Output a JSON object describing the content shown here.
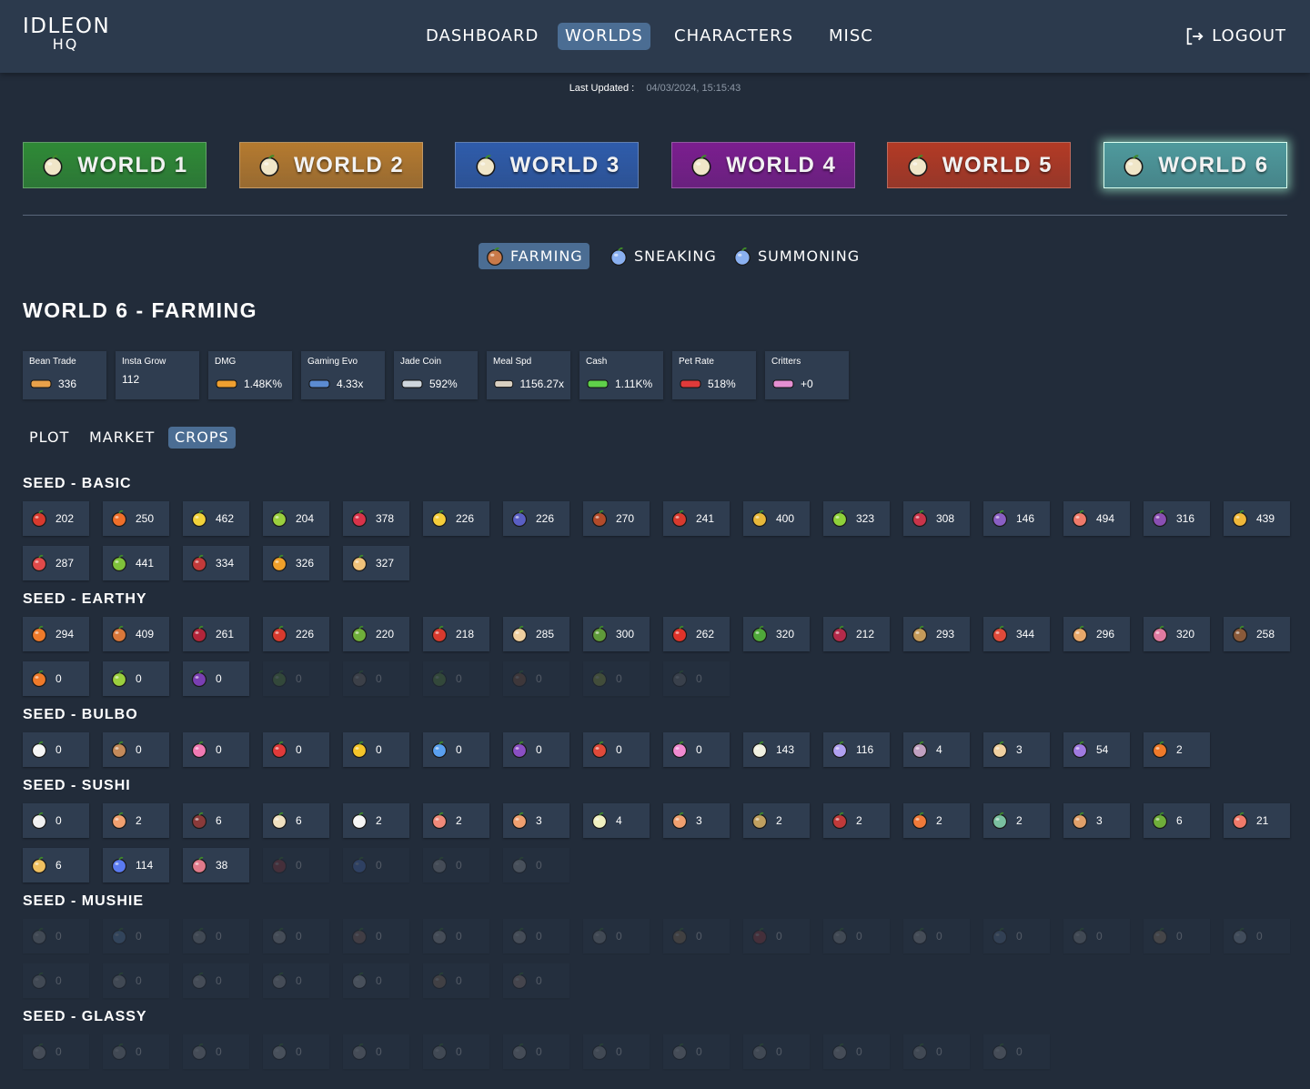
{
  "app": {
    "logo_line1": "IDLEON",
    "logo_line2": "HQ"
  },
  "nav": [
    {
      "label": "DASHBOARD",
      "active": false
    },
    {
      "label": "WORLDS",
      "active": true
    },
    {
      "label": "CHARACTERS",
      "active": false
    },
    {
      "label": "MISC",
      "active": false
    }
  ],
  "logout_label": "LOGOUT",
  "last_updated": {
    "label": "Last Updated :",
    "value": "04/03/2024, 15:15:43"
  },
  "worlds": [
    {
      "label": "WORLD 1",
      "color": "#2f8a36",
      "icon": "bush-icon"
    },
    {
      "label": "WORLD 2",
      "color": "#b57a2f",
      "icon": "desert-icon"
    },
    {
      "label": "WORLD 3",
      "color": "#2f5cab",
      "icon": "snow-icon"
    },
    {
      "label": "WORLD 4",
      "color": "#7b1e8f",
      "icon": "space-icon"
    },
    {
      "label": "WORLD 5",
      "color": "#b33a25",
      "icon": "lava-icon"
    },
    {
      "label": "WORLD 6",
      "color": "#4f9a9d",
      "icon": "spirit-icon",
      "active": true
    }
  ],
  "subnav": [
    {
      "label": "FARMING",
      "active": true,
      "icon": "farming-icon"
    },
    {
      "label": "SNEAKING",
      "active": false,
      "icon": "sneaking-icon"
    },
    {
      "label": "SUMMONING",
      "active": false,
      "icon": "summoning-icon"
    }
  ],
  "page_title": "WORLD 6 - FARMING",
  "stats": [
    {
      "label": "Bean Trade",
      "value": "336",
      "icon": "bean-icon",
      "color": "#e8a14a"
    },
    {
      "label": "Insta Grow",
      "value": "112"
    },
    {
      "label": "DMG",
      "value": "1.48K%",
      "icon": "dmg-icon",
      "color": "#f0a030"
    },
    {
      "label": "Gaming Evo",
      "value": "4.33x",
      "icon": "evo-icon",
      "color": "#5b8bd1"
    },
    {
      "label": "Jade Coin",
      "value": "592%",
      "icon": "jade-icon",
      "color": "#cfd6dd"
    },
    {
      "label": "Meal Spd",
      "value": "1156.27x",
      "icon": "meal-icon",
      "color": "#d9d0c1"
    },
    {
      "label": "Cash",
      "value": "1.11K%",
      "icon": "cash-icon",
      "color": "#5fd14a"
    },
    {
      "label": "Pet Rate",
      "value": "518%",
      "icon": "pet-icon",
      "color": "#e03a3a"
    },
    {
      "label": "Critters",
      "value": "+0",
      "icon": "critter-icon",
      "color": "#e48fd2"
    }
  ],
  "tabs": [
    {
      "label": "PLOT",
      "active": false
    },
    {
      "label": "MARKET",
      "active": false
    },
    {
      "label": "CROPS",
      "active": true
    }
  ],
  "sections": [
    {
      "title": "SEED - BASIC",
      "crops": [
        {
          "v": "202",
          "c": "#d83a2e",
          "i": "apple-icon"
        },
        {
          "v": "250",
          "c": "#ef6f2a",
          "i": "orange-icon"
        },
        {
          "v": "462",
          "c": "#f2d23a",
          "i": "lemon-icon"
        },
        {
          "v": "204",
          "c": "#9bcf3e",
          "i": "pear-icon"
        },
        {
          "v": "378",
          "c": "#d9334a",
          "i": "strawberry-icon"
        },
        {
          "v": "226",
          "c": "#f5cd3a",
          "i": "banana-icon"
        },
        {
          "v": "226",
          "c": "#5a5fc4",
          "i": "blueberry-icon"
        },
        {
          "v": "270",
          "c": "#b34b2a",
          "i": "raspberry-icon"
        },
        {
          "v": "241",
          "c": "#d83a2e",
          "i": "cherry-icon"
        },
        {
          "v": "400",
          "c": "#e8b83a",
          "i": "pineapple-icon"
        },
        {
          "v": "323",
          "c": "#8fd13a",
          "i": "lime-icon"
        },
        {
          "v": "308",
          "c": "#c9344a",
          "i": "berry-icon"
        },
        {
          "v": "146",
          "c": "#8a5fc4",
          "i": "fig-icon"
        },
        {
          "v": "494",
          "c": "#f07a6a",
          "i": "peach-icon"
        },
        {
          "v": "316",
          "c": "#8a4fb3",
          "i": "grape-icon"
        },
        {
          "v": "439",
          "c": "#f0b83a",
          "i": "quince-icon"
        },
        {
          "v": "287",
          "c": "#e04a4a",
          "i": "watermelon-icon"
        },
        {
          "v": "441",
          "c": "#7fc23a",
          "i": "green-grape-icon"
        },
        {
          "v": "334",
          "c": "#c23a3a",
          "i": "lychee-icon"
        },
        {
          "v": "326",
          "c": "#f0a02a",
          "i": "mango-icon"
        },
        {
          "v": "327",
          "c": "#f0c27a",
          "i": "cake-icon"
        }
      ]
    },
    {
      "title": "SEED - EARTHY",
      "crops": [
        {
          "v": "294",
          "c": "#ef7a2a",
          "i": "carrot-icon"
        },
        {
          "v": "409",
          "c": "#d9773a",
          "i": "sweet-potato-icon"
        },
        {
          "v": "261",
          "c": "#b3253a",
          "i": "radish-icon"
        },
        {
          "v": "226",
          "c": "#d83a2e",
          "i": "tomato-icon"
        },
        {
          "v": "220",
          "c": "#6fae3a",
          "i": "artichoke-icon"
        },
        {
          "v": "218",
          "c": "#d83a2e",
          "i": "pepper-icon"
        },
        {
          "v": "285",
          "c": "#f0d0a0",
          "i": "garlic-icon"
        },
        {
          "v": "300",
          "c": "#5f9a3a",
          "i": "avocado-icon"
        },
        {
          "v": "262",
          "c": "#e0332a",
          "i": "chili-icon"
        },
        {
          "v": "320",
          "c": "#4fa83a",
          "i": "broccoli-icon"
        },
        {
          "v": "212",
          "c": "#b32a4a",
          "i": "beet-icon"
        },
        {
          "v": "293",
          "c": "#c49a5a",
          "i": "nut-icon"
        },
        {
          "v": "344",
          "c": "#e04a3a",
          "i": "citrus-slice-icon"
        },
        {
          "v": "296",
          "c": "#e8a86a",
          "i": "bread-icon"
        },
        {
          "v": "320",
          "c": "#e07aa0",
          "i": "turnip-icon"
        },
        {
          "v": "258",
          "c": "#8a5a3a",
          "i": "coconut-icon"
        },
        {
          "v": "0",
          "c": "#ef7a2a",
          "i": "pumpkin-icon"
        },
        {
          "v": "0",
          "c": "#9bcf3e",
          "i": "kiwi-icon"
        },
        {
          "v": "0",
          "c": "#7a3fb3",
          "i": "eggplant-icon"
        },
        {
          "v": "0",
          "c": "#6fae3a",
          "i": "cabbage-icon",
          "locked": true
        },
        {
          "v": "0",
          "c": "#9a8a7a",
          "i": "onion-icon",
          "locked": true
        },
        {
          "v": "0",
          "c": "#6fae3a",
          "i": "bean-pod-icon",
          "locked": true
        },
        {
          "v": "0",
          "c": "#a0603a",
          "i": "potato-icon",
          "locked": true
        },
        {
          "v": "0",
          "c": "#b3c23a",
          "i": "corn-icon",
          "locked": true
        },
        {
          "v": "0",
          "c": "#8a8a8a",
          "i": "stone-fruit-icon",
          "locked": true
        }
      ]
    },
    {
      "title": "SEED - BULBO",
      "crops": [
        {
          "v": "0",
          "c": "#f5f5f5",
          "i": "daisy-icon"
        },
        {
          "v": "0",
          "c": "#c48a5a",
          "i": "burger-icon"
        },
        {
          "v": "0",
          "c": "#f07ab3",
          "i": "lily-icon"
        },
        {
          "v": "0",
          "c": "#e03a3a",
          "i": "rose-icon"
        },
        {
          "v": "0",
          "c": "#f5c52a",
          "i": "sunflower-icon"
        },
        {
          "v": "0",
          "c": "#5aa0f0",
          "i": "blue-flower-icon"
        },
        {
          "v": "0",
          "c": "#8a4fc4",
          "i": "violet-icon"
        },
        {
          "v": "0",
          "c": "#e04a3a",
          "i": "tulip-icon"
        },
        {
          "v": "0",
          "c": "#f08ad0",
          "i": "pink-flower-icon"
        },
        {
          "v": "143",
          "c": "#f0f0e0",
          "i": "cauliflower-icon"
        },
        {
          "v": "116",
          "c": "#b0a0f0",
          "i": "aster-icon"
        },
        {
          "v": "4",
          "c": "#c0a0c0",
          "i": "orchid-icon"
        },
        {
          "v": "3",
          "c": "#f0d0a0",
          "i": "muffin-icon"
        },
        {
          "v": "54",
          "c": "#a07ae0",
          "i": "lotus-icon"
        },
        {
          "v": "2",
          "c": "#f07a2a",
          "i": "flame-flower-icon"
        }
      ]
    },
    {
      "title": "SEED - SUSHI",
      "crops": [
        {
          "v": "0",
          "c": "#f0f0f0",
          "i": "maki-icon"
        },
        {
          "v": "2",
          "c": "#f0a070",
          "i": "nigiri-icon"
        },
        {
          "v": "6",
          "c": "#8a3a3a",
          "i": "roll-icon"
        },
        {
          "v": "6",
          "c": "#f0e0c0",
          "i": "sashimi-icon"
        },
        {
          "v": "2",
          "c": "#f5f5f5",
          "i": "onigiri-icon"
        },
        {
          "v": "2",
          "c": "#f08a7a",
          "i": "salmon-icon"
        },
        {
          "v": "3",
          "c": "#f0a070",
          "i": "cup-icon"
        },
        {
          "v": "4",
          "c": "#f0f0c0",
          "i": "temaki-icon"
        },
        {
          "v": "3",
          "c": "#f0a070",
          "i": "tempura-icon"
        },
        {
          "v": "2",
          "c": "#c0a060",
          "i": "gyoza-icon"
        },
        {
          "v": "2",
          "c": "#c03a3a",
          "i": "tuna-icon"
        },
        {
          "v": "2",
          "c": "#f07a3a",
          "i": "orange-roll-icon"
        },
        {
          "v": "2",
          "c": "#7ac0a0",
          "i": "bowl-icon"
        },
        {
          "v": "3",
          "c": "#e0a06a",
          "i": "dumpling-icon"
        },
        {
          "v": "6",
          "c": "#6fae3a",
          "i": "green-roll-icon"
        },
        {
          "v": "21",
          "c": "#f07a6a",
          "i": "ebi-icon"
        },
        {
          "v": "6",
          "c": "#f0c060",
          "i": "tamago-icon"
        },
        {
          "v": "114",
          "c": "#5a7af0",
          "i": "roe-icon"
        },
        {
          "v": "38",
          "c": "#e07a8a",
          "i": "platter-icon"
        },
        {
          "v": "0",
          "c": "#c03a3a",
          "i": "sauce-icon",
          "locked": true
        },
        {
          "v": "0",
          "c": "#5a8af0",
          "i": "fish-icon",
          "locked": true
        },
        {
          "v": "0",
          "c": "#c0c0c0",
          "i": "jar-icon",
          "locked": true
        },
        {
          "v": "0",
          "c": "#d0d0d0",
          "i": "shrimp-icon",
          "locked": true
        }
      ]
    },
    {
      "title": "SEED - MUSHIE",
      "crops": [
        {
          "v": "0",
          "c": "#b0b0b0",
          "i": "mushroom-icon",
          "locked": true
        },
        {
          "v": "0",
          "c": "#6a9ad0",
          "i": "mushroom-icon",
          "locked": true
        },
        {
          "v": "0",
          "c": "#b0b0b0",
          "i": "mushroom-icon",
          "locked": true
        },
        {
          "v": "0",
          "c": "#c0c0c0",
          "i": "mushroom-icon",
          "locked": true
        },
        {
          "v": "0",
          "c": "#b07a6a",
          "i": "mushroom-icon",
          "locked": true
        },
        {
          "v": "0",
          "c": "#c0c0c0",
          "i": "mushroom-icon",
          "locked": true
        },
        {
          "v": "0",
          "c": "#c0c0c0",
          "i": "mushroom-icon",
          "locked": true
        },
        {
          "v": "0",
          "c": "#b0b0b0",
          "i": "mushroom-icon",
          "locked": true
        },
        {
          "v": "0",
          "c": "#b08a5a",
          "i": "mushroom-icon",
          "locked": true
        },
        {
          "v": "0",
          "c": "#c03a3a",
          "i": "mushroom-icon",
          "locked": true
        },
        {
          "v": "0",
          "c": "#b0b0b0",
          "i": "mushroom-icon",
          "locked": true
        },
        {
          "v": "0",
          "c": "#c0c0c0",
          "i": "mushroom-icon",
          "locked": true
        },
        {
          "v": "0",
          "c": "#6a8ab0",
          "i": "mushroom-icon",
          "locked": true
        },
        {
          "v": "0",
          "c": "#b0b0b0",
          "i": "mushroom-icon",
          "locked": true
        },
        {
          "v": "0",
          "c": "#c0a07a",
          "i": "mushroom-icon",
          "locked": true
        },
        {
          "v": "0",
          "c": "#b0c0d0",
          "i": "mushroom-icon",
          "locked": true
        },
        {
          "v": "0",
          "c": "#b0b0b0",
          "i": "mushroom-icon",
          "locked": true
        },
        {
          "v": "0",
          "c": "#b0b0b0",
          "i": "mushroom-icon",
          "locked": true
        },
        {
          "v": "0",
          "c": "#c0c0c0",
          "i": "mushroom-icon",
          "locked": true
        },
        {
          "v": "0",
          "c": "#c0c0c0",
          "i": "mushroom-icon",
          "locked": true
        },
        {
          "v": "0",
          "c": "#d0d0d0",
          "i": "mushroom-icon",
          "locked": true
        },
        {
          "v": "0",
          "c": "#b08a6a",
          "i": "mushroom-icon",
          "locked": true
        },
        {
          "v": "0",
          "c": "#c0a090",
          "i": "mushroom-icon",
          "locked": true
        }
      ]
    },
    {
      "title": "SEED - GLASSY",
      "crops": [
        {
          "v": "0",
          "c": "#c0c0c0",
          "i": "glass-banana-icon",
          "locked": true
        },
        {
          "v": "0",
          "c": "#b0b0b0",
          "i": "glass-pepper-icon",
          "locked": true
        },
        {
          "v": "0",
          "c": "#c0c0c0",
          "i": "glass-mushroom-icon",
          "locked": true
        },
        {
          "v": "0",
          "c": "#d0d0d0",
          "i": "glass-jar-icon",
          "locked": true
        },
        {
          "v": "0",
          "c": "#c0c0c0",
          "i": "glass-flower-icon",
          "locked": true
        },
        {
          "v": "0",
          "c": "#b0b0b0",
          "i": "glass-carrot-icon",
          "locked": true
        },
        {
          "v": "0",
          "c": "#c0c0c0",
          "i": "glass-orb-icon",
          "locked": true
        },
        {
          "v": "0",
          "c": "#b0b0b0",
          "i": "glass-melon-icon",
          "locked": true
        },
        {
          "v": "0",
          "c": "#c0c0c0",
          "i": "glass-chili-icon",
          "locked": true
        },
        {
          "v": "0",
          "c": "#b0b0b0",
          "i": "glass-cluster-icon",
          "locked": true
        },
        {
          "v": "0",
          "c": "#c0c0c0",
          "i": "glass-corn-icon",
          "locked": true
        },
        {
          "v": "0",
          "c": "#b0b0b0",
          "i": "glass-donut-icon",
          "locked": true
        },
        {
          "v": "0",
          "c": "#c0c0c0",
          "i": "glass-gem-icon",
          "locked": true
        }
      ]
    }
  ]
}
